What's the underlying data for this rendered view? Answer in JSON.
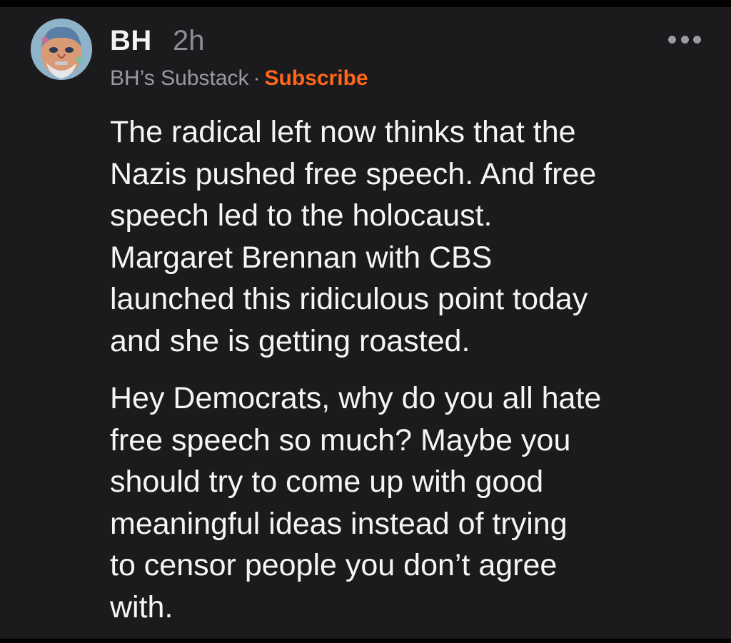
{
  "post": {
    "author": "BH",
    "time": "2h",
    "publication": "BH’s Substack",
    "separator": "·",
    "subscribe_label": "Subscribe",
    "paragraphs": [
      "The radical left now thinks that the\nNazis pushed free speech. And free\nspeech led to the holocaust.\nMargaret Brennan with CBS\nlaunched this ridiculous point today\nand she is getting roasted.",
      "Hey Democrats, why do you all hate\nfree speech so much? Maybe you\nshould try to come up with good\nmeaningful ideas instead of trying\nto censor people you don’t agree\nwith."
    ]
  },
  "icons": {
    "more": "more-horizontal-icon",
    "avatar": "avatar-portrait"
  },
  "colors": {
    "background": "#1b1b1d",
    "text": "#f5f5f5",
    "muted": "#9a9a9f",
    "accent": "#ff6719"
  }
}
